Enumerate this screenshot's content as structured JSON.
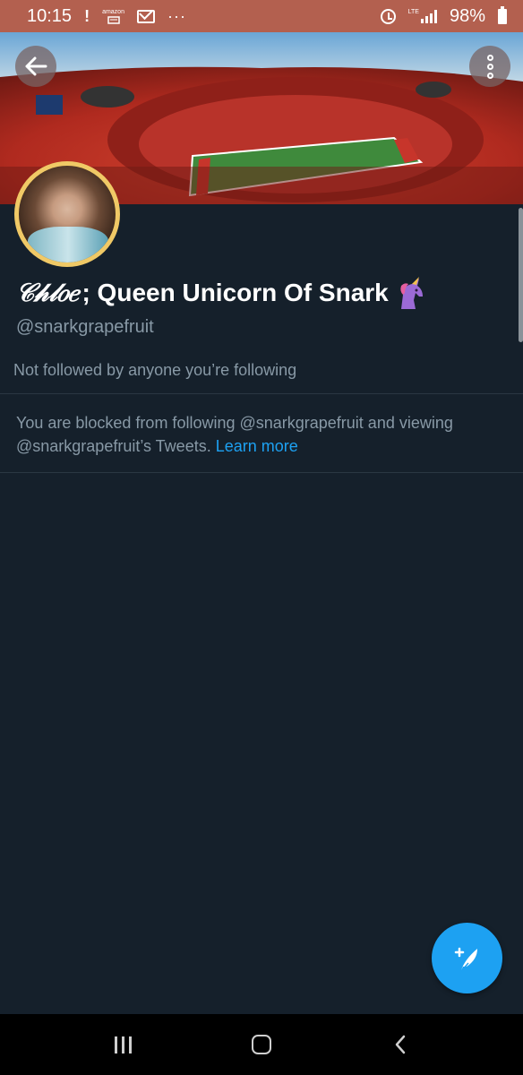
{
  "status_bar": {
    "time": "10:15",
    "alert_glyph": "!",
    "amazon_text": "amazon",
    "overflow_dots": "···",
    "network_label": "LTE",
    "battery_percent": "98%",
    "icons": [
      "notification-alert-icon",
      "amazon-icon",
      "gmail-icon",
      "more-notifications-icon",
      "alarm-icon",
      "signal-icon",
      "battery-icon"
    ]
  },
  "profile": {
    "name_script": "𝒞𝒽𝓁𝑜𝑒",
    "name_rest": "; Queen Unicorn Of Snark",
    "name_emoji": "unicorn-icon",
    "handle": "@snarkgrapefruit",
    "followed_by": "Not followed by anyone you’re following",
    "blocked_message": "You are blocked from following @snarkgrapefruit and viewing @snarkgrapefruit’s Tweets.",
    "learn_more": "Learn more"
  },
  "colors": {
    "background": "#15202b",
    "status_bar": "#b3604f",
    "accent": "#1da1f2",
    "secondary_text": "#8899a6",
    "avatar_ring": "#f0c966"
  },
  "actions": {
    "back": "back-arrow-icon",
    "more": "more-vertical-icon",
    "compose": "compose-tweet-icon"
  },
  "nav": [
    "recents-icon",
    "home-icon",
    "back-icon"
  ]
}
